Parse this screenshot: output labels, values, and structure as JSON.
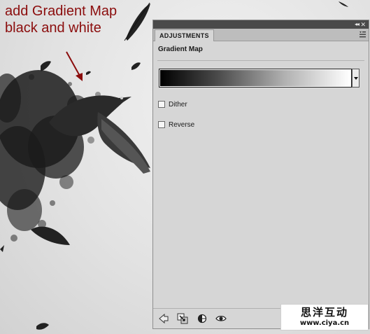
{
  "annotation": {
    "text": "add Gradient Map\nblack and white",
    "color": "#8b0d0d"
  },
  "panel": {
    "tab_label": "ADJUSTMENTS",
    "collapse_glyph": "◂◂",
    "close_glyph": "✕",
    "menu_icon": "panel-menu-icon",
    "title": "Gradient Map",
    "gradient": {
      "stops": [
        "#000000",
        "#ffffff"
      ],
      "dropdown_icon": "dropdown-arrow-icon"
    },
    "options": [
      {
        "id": "dither",
        "label": "Dither",
        "checked": false
      },
      {
        "id": "reverse",
        "label": "Reverse",
        "checked": false
      }
    ],
    "toolbar": [
      "back-arrow-icon",
      "clip-to-layer-icon",
      "previous-state-icon",
      "visibility-eye-icon"
    ]
  },
  "watermark": {
    "chinese": "思洋互动",
    "url": "www.ciya.cn"
  }
}
